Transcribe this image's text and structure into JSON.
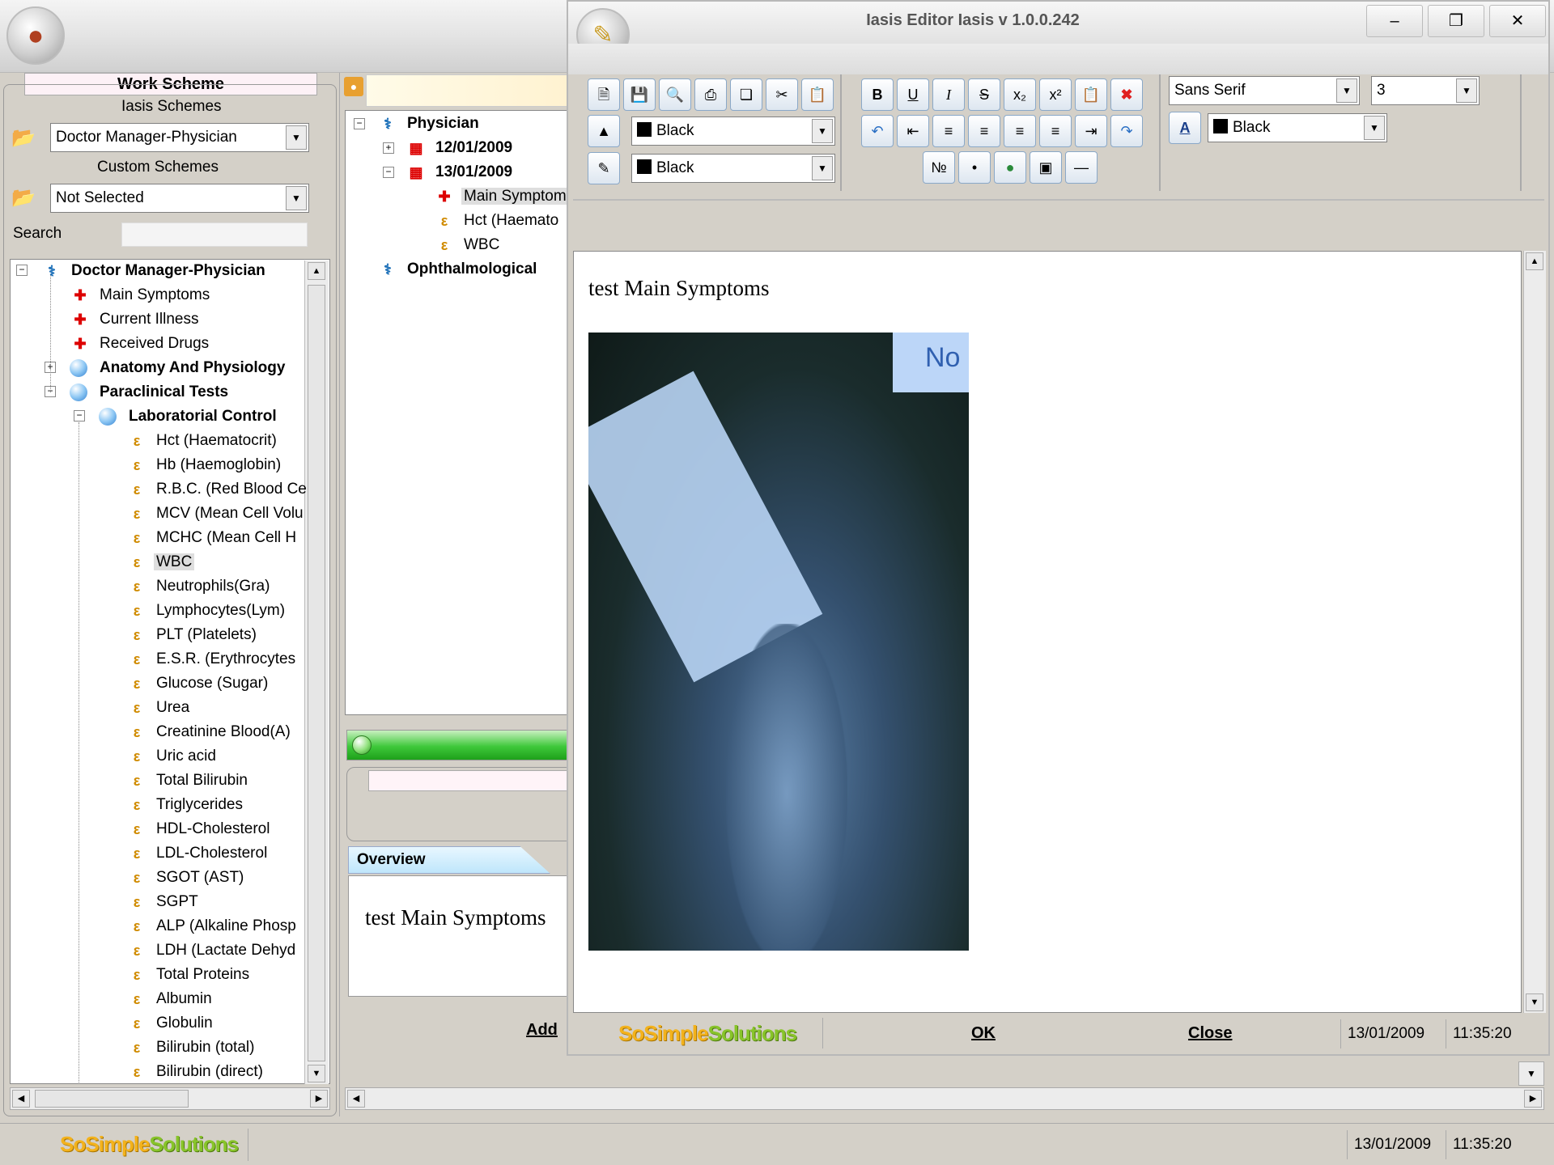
{
  "left_panel": {
    "title": "Work Scheme",
    "iasis_schemes_label": "Iasis Schemes",
    "iasis_scheme_value": "Doctor Manager-Physician",
    "custom_schemes_label": "Custom Schemes",
    "custom_scheme_value": "Not Selected",
    "search_label": "Search",
    "tree": [
      {
        "label": "Doctor Manager-Physician",
        "bold": true
      },
      {
        "label": "Main Symptoms"
      },
      {
        "label": "Current Illness"
      },
      {
        "label": "Received Drugs"
      },
      {
        "label": "Anatomy And Physiology",
        "bold": true
      },
      {
        "label": "Paraclinical Tests",
        "bold": true
      },
      {
        "label": "Laboratorial Control",
        "bold": true
      },
      {
        "label": "Hct (Haematocrit)"
      },
      {
        "label": "Hb (Haemoglobin)"
      },
      {
        "label": "R.B.C. (Red Blood Ce"
      },
      {
        "label": "MCV (Mean Cell Volu"
      },
      {
        "label": "MCHC  (Mean Cell H"
      },
      {
        "label": "WBC",
        "selected": true
      },
      {
        "label": "Neutrophils(Gra)"
      },
      {
        "label": "Lymphocytes(Lym)"
      },
      {
        "label": "PLT (Platelets)"
      },
      {
        "label": "E.S.R. (Erythrocytes"
      },
      {
        "label": "Glucose (Sugar)"
      },
      {
        "label": "Urea"
      },
      {
        "label": "Creatinine Blood(A)"
      },
      {
        "label": "Uric acid"
      },
      {
        "label": "Total Bilirubin"
      },
      {
        "label": "Triglycerides"
      },
      {
        "label": "HDL-Cholesterol"
      },
      {
        "label": "LDL-Cholesterol"
      },
      {
        "label": "SGOT (AST)"
      },
      {
        "label": "SGPT"
      },
      {
        "label": "ALP (Alkaline Phosp"
      },
      {
        "label": "LDH (Lactate Dehyd"
      },
      {
        "label": "Total Proteins"
      },
      {
        "label": "Albumin"
      },
      {
        "label": "Globulin"
      },
      {
        "label": "Bilirubin (total)"
      },
      {
        "label": "Bilirubin (direct)"
      }
    ]
  },
  "middle_panel": {
    "tree": [
      {
        "label": "Physician",
        "bold": true
      },
      {
        "label": "12/01/2009",
        "bold": true
      },
      {
        "label": "13/01/2009",
        "bold": true
      },
      {
        "label": "Main Symptom",
        "selected": true
      },
      {
        "label": "Hct (Haemato"
      },
      {
        "label": "WBC"
      },
      {
        "label": "Ophthalmological",
        "bold": true
      }
    ],
    "overview_tab": "Overview",
    "overview_text": "test Main Symptoms",
    "add_label": "Add"
  },
  "editor": {
    "title": "Iasis Editor Iasis  v 1.0.0.242",
    "highlight_color": "Black",
    "background_color": "Black",
    "font_name": "Sans Serif",
    "font_size": "3",
    "text_color": "Black",
    "content_text": "test Main Symptoms",
    "ok_label": "OK",
    "close_label": "Close",
    "date": "13/01/2009",
    "time": "11:35:20",
    "xray_label_fragment": "No"
  },
  "brand": {
    "part1": "SoSimple",
    "part2": "Solutions"
  },
  "statusbar": {
    "date": "13/01/2009",
    "time": "11:35:20"
  }
}
